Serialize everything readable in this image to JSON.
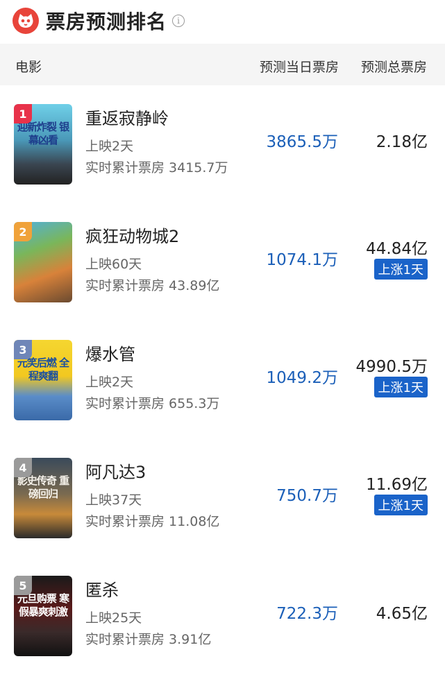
{
  "header": {
    "title": "票房预测排名",
    "info_icon": "info-icon",
    "logo_icon": "cat-face-icon"
  },
  "columns": {
    "movie": "电影",
    "daily": "预测当日票房",
    "total": "预测总票房"
  },
  "colors": {
    "daily_blue": "#1b5fb8",
    "badge_blue": "#1a63c9",
    "logo_red": "#e8443a"
  },
  "movies": [
    {
      "rank": "1",
      "name": "重返寂静岭",
      "days": "上映2天",
      "cumulative": "实时累计票房 3415.7万",
      "daily": "3865.5万",
      "total": "2.18亿",
      "rise": "",
      "poster_text": "迎新炸裂 银幕凶看",
      "badge_color": "#e8324a"
    },
    {
      "rank": "2",
      "name": "疯狂动物城2",
      "days": "上映60天",
      "cumulative": "实时累计票房 43.89亿",
      "daily": "1074.1万",
      "total": "44.84亿",
      "rise": "上涨1天",
      "poster_text": "",
      "badge_color": "#f0a23a"
    },
    {
      "rank": "3",
      "name": "爆水管",
      "days": "上映2天",
      "cumulative": "实时累计票房 655.3万",
      "daily": "1049.2万",
      "total": "4990.5万",
      "rise": "上涨1天",
      "poster_text": "元笑后燃 全程爽翻",
      "badge_color": "#6f86b8"
    },
    {
      "rank": "4",
      "name": "阿凡达3",
      "days": "上映37天",
      "cumulative": "实时累计票房 11.08亿",
      "daily": "750.7万",
      "total": "11.69亿",
      "rise": "上涨1天",
      "poster_text": "影史传奇 重磅回归",
      "badge_color": "#9a9a9a"
    },
    {
      "rank": "5",
      "name": "匿杀",
      "days": "上映25天",
      "cumulative": "实时累计票房 3.91亿",
      "daily": "722.3万",
      "total": "4.65亿",
      "rise": "",
      "poster_text": "元旦购票 寒假暴爽刺激",
      "badge_color": "#9a9a9a"
    }
  ]
}
